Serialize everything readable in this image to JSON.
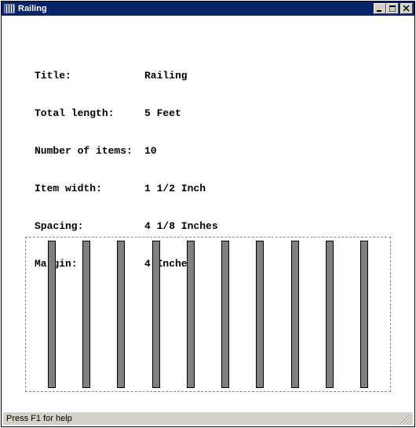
{
  "window": {
    "title": "Railing"
  },
  "info": {
    "rows": [
      {
        "label": "Title:",
        "value": "Railing"
      },
      {
        "label": "Total length:",
        "value": "5 Feet"
      },
      {
        "label": "Number of items:",
        "value": "10"
      },
      {
        "label": "Item width:",
        "value": "1 1/2 Inch"
      },
      {
        "label": "Spacing:",
        "value": "4 1/8 Inches"
      },
      {
        "label": "Margin:",
        "value": "4 Inches"
      }
    ]
  },
  "railing": {
    "count": 10
  },
  "statusbar": {
    "text": "Press F1 for help"
  }
}
